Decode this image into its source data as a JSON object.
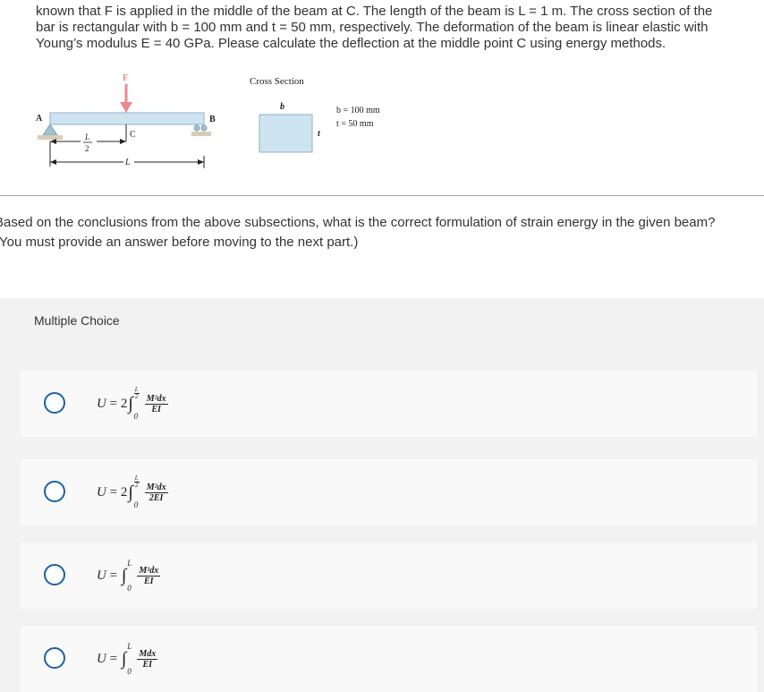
{
  "problem": {
    "line1": "known that F is applied in the middle of the beam at C. The length of the beam is L = 1 m. The cross section of the",
    "line2": "bar is rectangular with b = 100 mm and t = 50 mm, respectively. The deformation of the beam is linear elastic with",
    "line3": "Young’s modulus E = 40 GPa. Please calculate the deflection at the middle point C using energy methods."
  },
  "figure": {
    "label_F": "F",
    "label_A": "A",
    "label_B": "B",
    "label_C": "C",
    "label_L": "L",
    "label_L_num": "L",
    "label_L_den": "2",
    "cross_section_title": "Cross Section",
    "label_b": "b",
    "label_t": "t",
    "dim_b": "b = 100 mm",
    "dim_t": "t = 50 mm",
    "colors": {
      "beam": "#cfe4f1",
      "beam_edge": "#8fb0c4",
      "arrow": "#e8898e",
      "support": "#9fc2d4",
      "ground": "#d8cdb8"
    }
  },
  "question": {
    "line1": "Based on the conclusions from the above subsections, what is the correct formulation of strain energy in the given beam?",
    "line2": "(You must provide an answer before moving to the next part.)"
  },
  "multiple_choice": {
    "header": "Multiple Choice",
    "options": [
      {
        "lhs": "U",
        "coef": "2",
        "lower": "0",
        "upper_num": "L",
        "upper_den": "2",
        "num": "M²dx",
        "den": "EI"
      },
      {
        "lhs": "U",
        "coef": "2",
        "lower": "0",
        "upper_num": "L",
        "upper_den": "2",
        "num": "M²dx",
        "den": "2EI"
      },
      {
        "lhs": "U",
        "coef": "",
        "lower": "0",
        "upper": "L",
        "num": "M²dx",
        "den": "EI"
      },
      {
        "lhs": "U",
        "coef": "",
        "lower": "0",
        "upper": "L",
        "num": "Mdx",
        "den": "EI"
      }
    ],
    "accent_color": "#1663a9"
  }
}
